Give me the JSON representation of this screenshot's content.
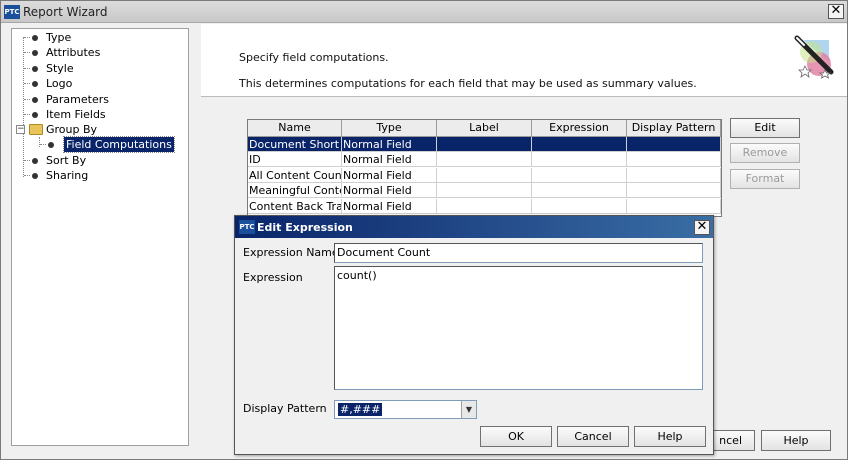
{
  "window": {
    "title": "Report Wizard",
    "logo": "PTC",
    "close_glyph": "✕"
  },
  "tree": {
    "items": [
      {
        "label": "Type"
      },
      {
        "label": "Attributes"
      },
      {
        "label": "Style"
      },
      {
        "label": "Logo"
      },
      {
        "label": "Parameters"
      },
      {
        "label": "Item Fields"
      },
      {
        "label": "Group By",
        "expander": "−"
      },
      {
        "label": "Field Computations",
        "selected": true
      },
      {
        "label": "Sort By"
      },
      {
        "label": "Sharing"
      }
    ]
  },
  "header": {
    "line1": "Specify field computations.",
    "line2": "This determines computations for each field that may be used as summary values.",
    "icon": "wizard-wand-icon"
  },
  "table": {
    "columns": [
      "Name",
      "Type",
      "Label",
      "Expression",
      "Display Pattern"
    ],
    "rows": [
      [
        "Document Short ...",
        "Normal Field",
        "",
        "",
        ""
      ],
      [
        "ID",
        "Normal Field",
        "",
        "",
        ""
      ],
      [
        "All Content Count",
        "Normal Field",
        "",
        "",
        ""
      ],
      [
        "Meaningful Conte...",
        "Normal Field",
        "",
        "",
        ""
      ],
      [
        "Content Back Tra...",
        "Normal Field",
        "",
        "",
        ""
      ]
    ],
    "selected_row": 0
  },
  "side_buttons": {
    "edit": "Edit",
    "remove": "Remove",
    "format": "Format"
  },
  "bottom_buttons": {
    "cancel_partial": "ncel",
    "help": "Help"
  },
  "dialog": {
    "title": "Edit Expression",
    "logo": "PTC",
    "close_glyph": "✕",
    "expression_name_label": "Expression Name",
    "expression_name_value": "Document Count",
    "expression_label": "Expression",
    "expression_value": "count()",
    "display_pattern_label": "Display Pattern",
    "display_pattern_value": "#,###",
    "dropdown_arrow": "▼",
    "ok": "OK",
    "cancel": "Cancel",
    "help": "Help"
  },
  "colors": {
    "selection": "#0a246a",
    "dialog_title_start": "#0a246a",
    "dialog_title_end": "#3a6ea5"
  }
}
